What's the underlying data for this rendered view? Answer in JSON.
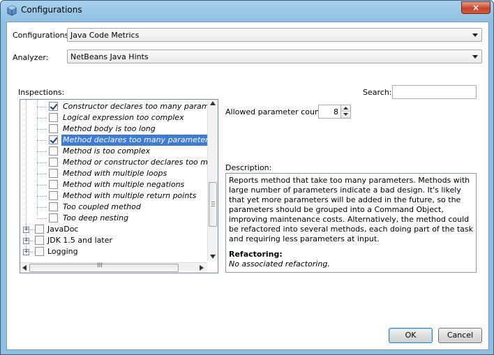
{
  "window": {
    "title": "Configurations",
    "close_glyph": "×"
  },
  "configurations": {
    "label": "Configurations:",
    "selected": "Java Code Metrics"
  },
  "analyzer": {
    "label": "Analyzer:",
    "selected": "NetBeans Java Hints"
  },
  "inspections": {
    "label": "Inspections:"
  },
  "search": {
    "label": "Search:",
    "value": ""
  },
  "tree": {
    "items": [
      {
        "label": "Constructor declares too many parameters",
        "checked": true,
        "italic": true,
        "selected": false
      },
      {
        "label": "Logical expression too complex",
        "checked": false,
        "italic": true,
        "selected": false
      },
      {
        "label": "Method body is too long",
        "checked": false,
        "italic": true,
        "selected": false
      },
      {
        "label": "Method declares too many parameters",
        "checked": true,
        "italic": true,
        "selected": true
      },
      {
        "label": "Method is too complex",
        "checked": false,
        "italic": true,
        "selected": false
      },
      {
        "label": "Method or constructor declares too many e",
        "checked": false,
        "italic": true,
        "selected": false
      },
      {
        "label": "Method with multiple loops",
        "checked": false,
        "italic": true,
        "selected": false
      },
      {
        "label": "Method with multiple negations",
        "checked": false,
        "italic": true,
        "selected": false
      },
      {
        "label": "Method with multiple return points",
        "checked": false,
        "italic": true,
        "selected": false
      },
      {
        "label": "Too coupled method",
        "checked": false,
        "italic": true,
        "selected": false
      },
      {
        "label": "Too deep nesting",
        "checked": false,
        "italic": true,
        "selected": false
      }
    ],
    "groups": [
      {
        "label": "JavaDoc",
        "expander": "+"
      },
      {
        "label": "JDK 1.5 and later",
        "expander": "+"
      },
      {
        "label": "Logging",
        "expander": "+"
      }
    ],
    "hscroll_grip": "III"
  },
  "options": {
    "param_count_label": "Allowed parameter count:",
    "param_count_value": "8"
  },
  "description": {
    "label": "Description:",
    "text": "Reports method that take too many parameters. Methods with large number of parameters indicate a bad design. It's likely that yet more parameters will be added in the future, so the parameters should be grouped into a Command Object, improving maintenance costs. Alternatively, the method could be refactored into several methods, each doing part of the task and requiring less parameters at input.",
    "refactoring_label": "Refactoring:",
    "refactoring_text": "No associated refactoring."
  },
  "buttons": {
    "ok": "OK",
    "cancel": "Cancel"
  },
  "colors": {
    "selection": "#3d7bd5",
    "title_bar": "#8fbfe1",
    "close_button": "#c5442b"
  }
}
